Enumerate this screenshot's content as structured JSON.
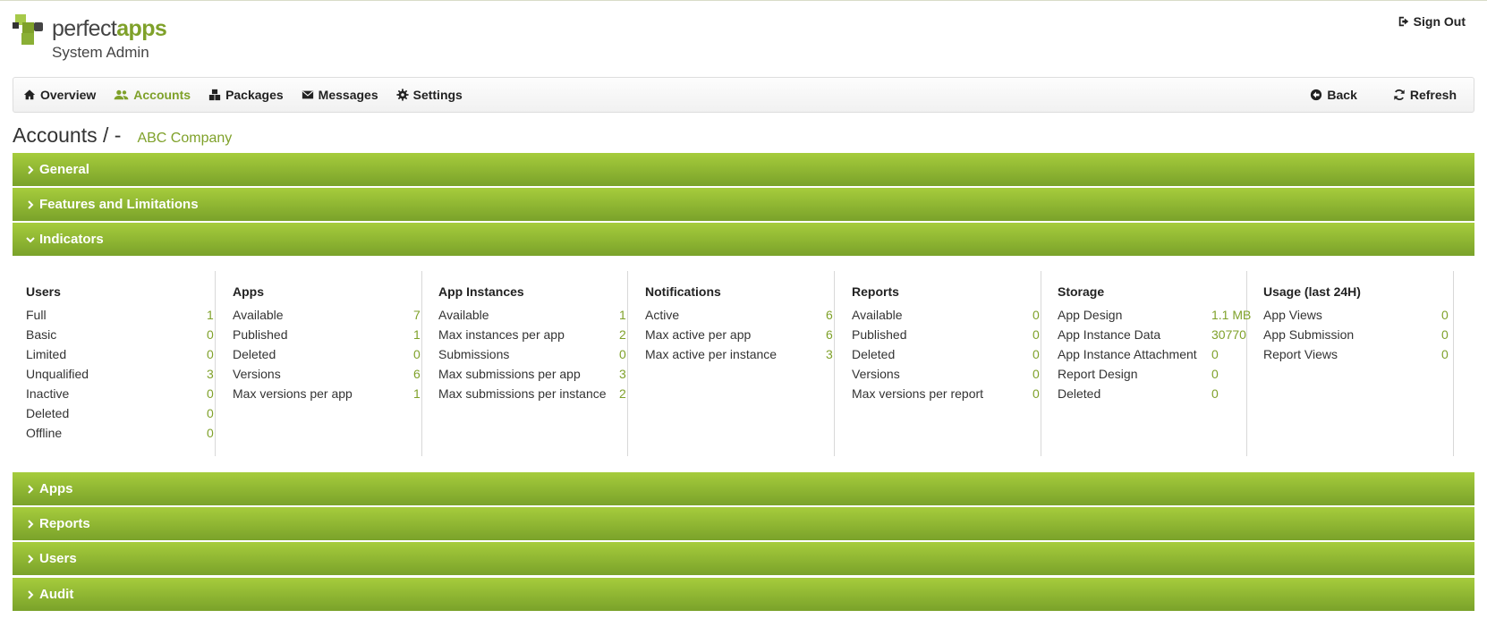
{
  "header": {
    "brand_main": "perfect",
    "brand_accent": "apps",
    "subtitle": "System Admin",
    "signout_label": "Sign Out"
  },
  "nav": {
    "items": [
      {
        "label": "Overview",
        "icon": "home-icon"
      },
      {
        "label": "Accounts",
        "icon": "users-icon",
        "active": true
      },
      {
        "label": "Packages",
        "icon": "boxes-icon"
      },
      {
        "label": "Messages",
        "icon": "envelope-icon"
      },
      {
        "label": "Settings",
        "icon": "gear-icon"
      }
    ],
    "back_label": "Back",
    "refresh_label": "Refresh"
  },
  "breadcrumb": {
    "section": "Accounts / -",
    "account": "ABC Company"
  },
  "panels": {
    "general": "General",
    "features": "Features and Limitations",
    "indicators": "Indicators",
    "apps": "Apps",
    "reports": "Reports",
    "users": "Users",
    "audit": "Audit"
  },
  "indicators": {
    "users": {
      "title": "Users",
      "rows": [
        {
          "label": "Full",
          "value": "1"
        },
        {
          "label": "Basic",
          "value": "0"
        },
        {
          "label": "Limited",
          "value": "0"
        },
        {
          "label": "Unqualified",
          "value": "3"
        },
        {
          "label": "Inactive",
          "value": "0"
        },
        {
          "label": "Deleted",
          "value": "0"
        },
        {
          "label": "Offline",
          "value": "0"
        }
      ]
    },
    "apps": {
      "title": "Apps",
      "rows": [
        {
          "label": "Available",
          "value": "7"
        },
        {
          "label": "Published",
          "value": "1"
        },
        {
          "label": "Deleted",
          "value": "0"
        },
        {
          "label": "Versions",
          "value": "6"
        },
        {
          "label": "Max versions per app",
          "value": "1"
        }
      ]
    },
    "instances": {
      "title": "App Instances",
      "rows": [
        {
          "label": "Available",
          "value": "1"
        },
        {
          "label": "Max instances per app",
          "value": "2"
        },
        {
          "label": "Submissions",
          "value": "0"
        },
        {
          "label": "Max submissions per app",
          "value": "3"
        },
        {
          "label": "Max submissions per instance",
          "value": "2"
        }
      ]
    },
    "notifications": {
      "title": "Notifications",
      "rows": [
        {
          "label": "Active",
          "value": "6"
        },
        {
          "label": "Max active per app",
          "value": "6"
        },
        {
          "label": "Max active per instance",
          "value": "3"
        }
      ]
    },
    "reports": {
      "title": "Reports",
      "rows": [
        {
          "label": "Available",
          "value": "0"
        },
        {
          "label": "Published",
          "value": "0"
        },
        {
          "label": "Deleted",
          "value": "0"
        },
        {
          "label": "Versions",
          "value": "0"
        },
        {
          "label": "Max versions per report",
          "value": "0"
        }
      ]
    },
    "storage": {
      "title": "Storage",
      "rows": [
        {
          "label": "App Design",
          "value": "1.1 MB"
        },
        {
          "label": "App Instance Data",
          "value": "30770"
        },
        {
          "label": "App Instance Attachment",
          "value": "0"
        },
        {
          "label": "Report Design",
          "value": "0"
        },
        {
          "label": "Deleted",
          "value": "0"
        }
      ]
    },
    "usage": {
      "title": "Usage (last 24H)",
      "rows": [
        {
          "label": "App Views",
          "value": "0"
        },
        {
          "label": "App Submission",
          "value": "0"
        },
        {
          "label": "Report Views",
          "value": "0"
        }
      ]
    }
  },
  "colors": {
    "accent": "#7fa12a",
    "panel_top": "#a6cc3c",
    "panel_bottom": "#7aa22a"
  }
}
